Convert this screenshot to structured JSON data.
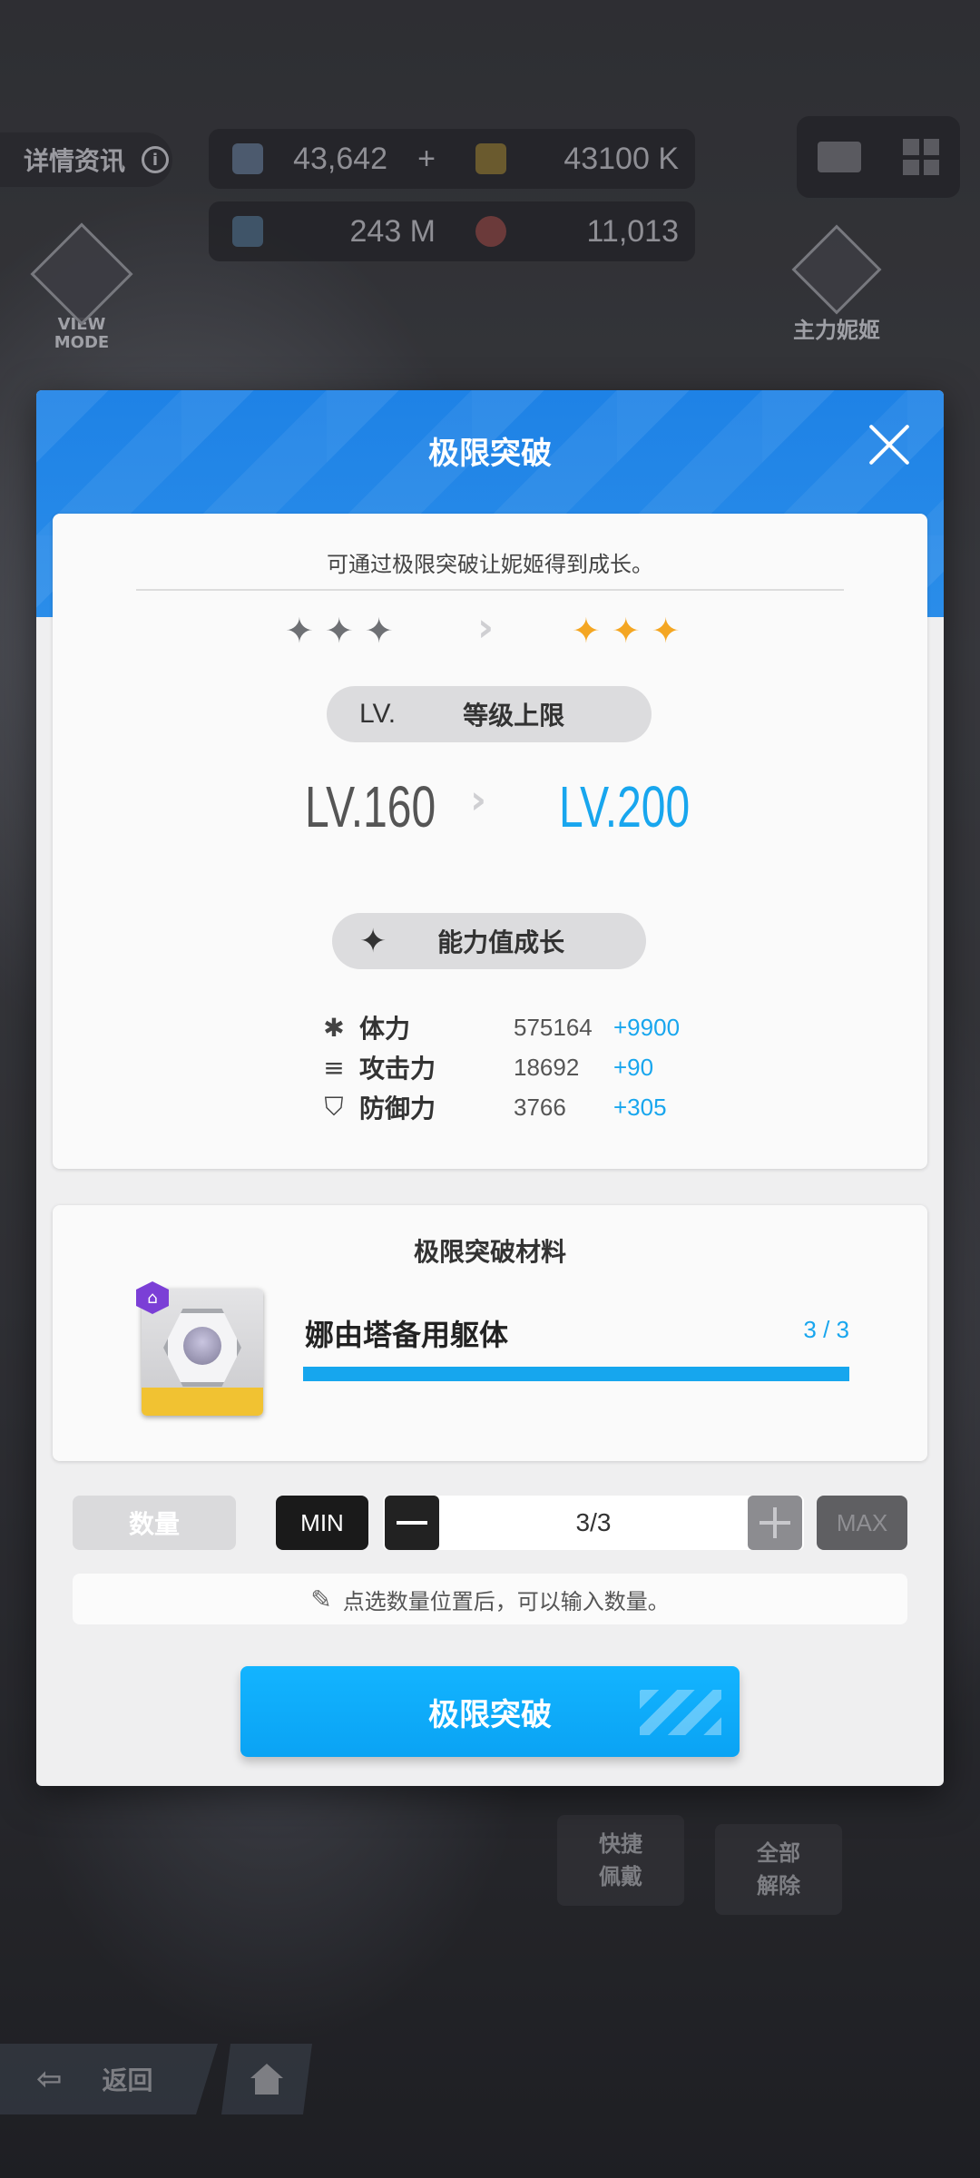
{
  "hud": {
    "details_tab": "详情资讯",
    "resources": [
      {
        "value": "43,642",
        "icon": "crystal-icon"
      },
      {
        "value": "43100 K",
        "icon": "credit-icon"
      },
      {
        "value": "243 M",
        "icon": "core-dust-icon"
      },
      {
        "value": "11,013",
        "icon": "body-label-icon"
      }
    ],
    "view_mode": "VIEW MODE",
    "main_nikke": "主力妮姬"
  },
  "modal": {
    "title": "极限突破",
    "description": "可通过极限突破让妮姬得到成长。",
    "stars_from": 3,
    "stars_to": 3,
    "level": {
      "mark": "LV.",
      "label": "等级上限",
      "old": "LV.160",
      "new": "LV.200"
    },
    "growth": {
      "label": "能力值成长",
      "stats": [
        {
          "icon": "hp-icon",
          "glyph": "✱",
          "name": "体力",
          "value": "575164",
          "add": "+9900"
        },
        {
          "icon": "attack-icon",
          "glyph": "≡",
          "name": "攻击力",
          "value": "18692",
          "add": "+90"
        },
        {
          "icon": "defense-icon",
          "glyph": "⛉",
          "name": "防御力",
          "value": "3766",
          "add": "+305"
        }
      ]
    },
    "material": {
      "title": "极限突破材料",
      "name": "娜由塔备用躯体",
      "count": "3 / 3",
      "progress": 1.0
    },
    "quantity": {
      "label": "数量",
      "min": "MIN",
      "value": "3/3",
      "max": "MAX",
      "hint": "点选数量位置后，可以输入数量。"
    },
    "confirm": "极限突破"
  },
  "bottom": {
    "quick_equip": "快捷佩戴",
    "remove_all": "全部解除",
    "back": "返回"
  },
  "colors": {
    "accent_blue": "#18a6ee",
    "header_blue": "#1e82e6",
    "gold_star": "#f4a622"
  }
}
